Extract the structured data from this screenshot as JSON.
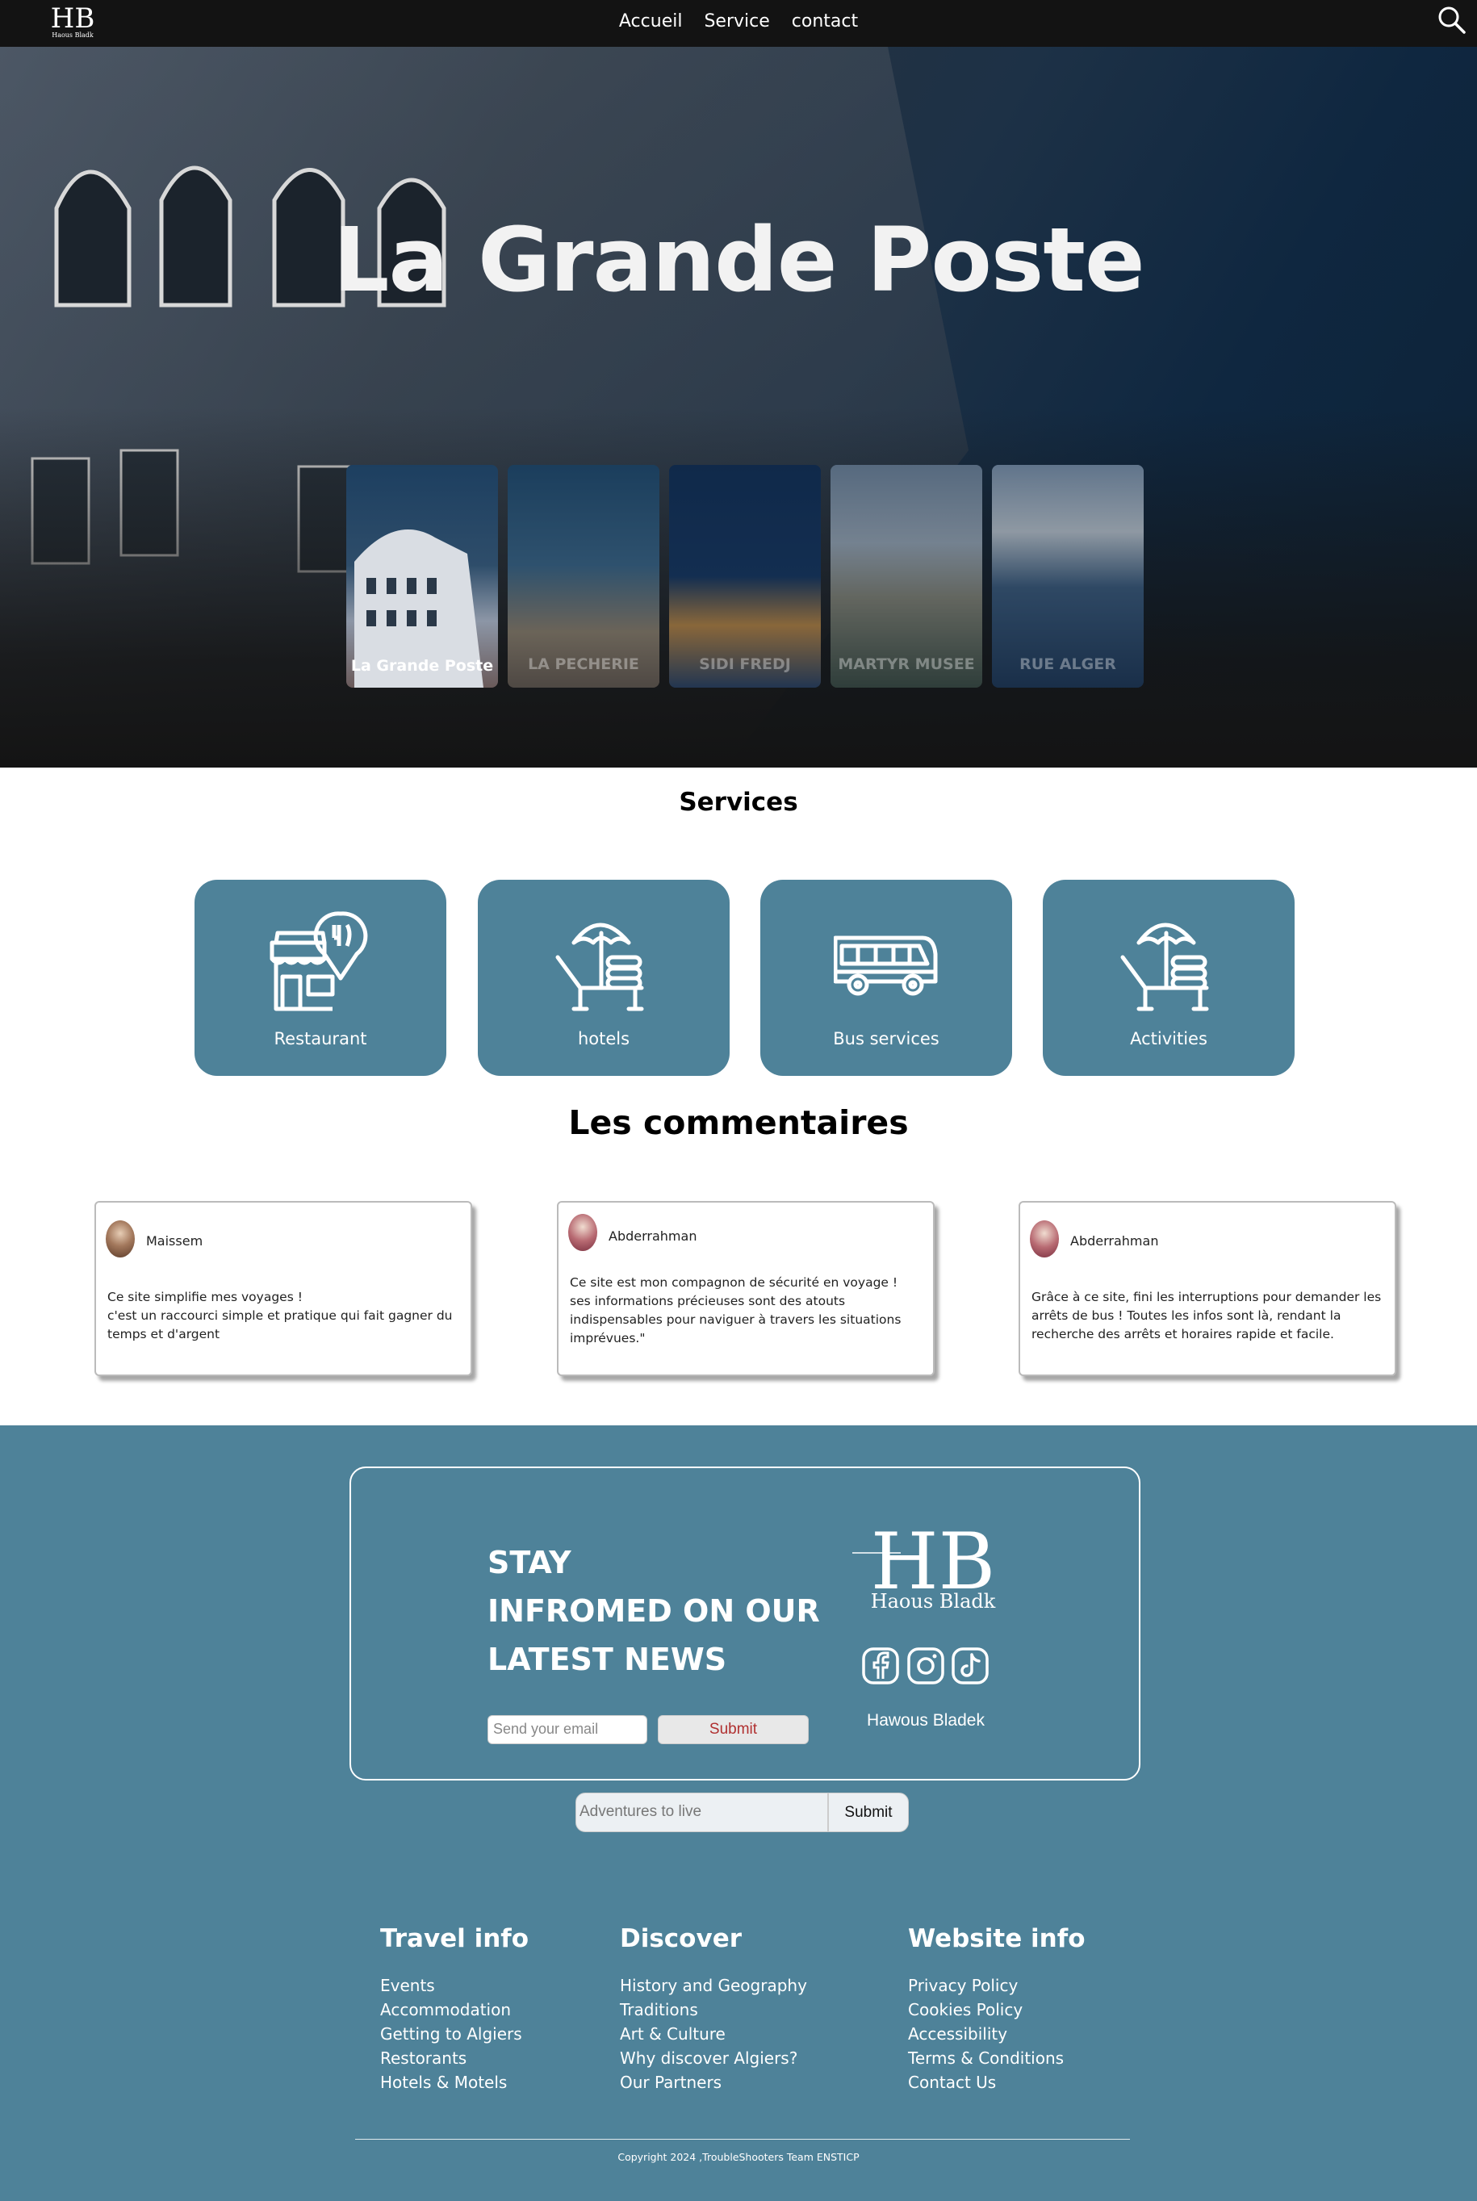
{
  "nav": {
    "logo_text": "HB",
    "logo_sub": "Haous Bladk",
    "links": [
      "Accueil",
      "Service",
      "contact"
    ]
  },
  "hero": {
    "title": "La Grande Poste",
    "cards": [
      {
        "label": "La Grande Poste",
        "active": true
      },
      {
        "label": "LA PECHERIE",
        "active": false
      },
      {
        "label": "SIDI FREDJ",
        "active": false
      },
      {
        "label": "MARTYR MUSEE",
        "active": false
      },
      {
        "label": "RUE ALGER",
        "active": false
      }
    ]
  },
  "services": {
    "title": "Services",
    "items": [
      {
        "label": "Restaurant",
        "icon": "restaurant-icon"
      },
      {
        "label": "hotels",
        "icon": "beach-chair-icon"
      },
      {
        "label": "Bus services",
        "icon": "bus-icon"
      },
      {
        "label": "Activities",
        "icon": "beach-chair-icon"
      }
    ]
  },
  "comments": {
    "title": "Les commentaires",
    "items": [
      {
        "name": "Maissem",
        "text": "Ce site simplifie mes voyages !\nc'est un raccourci simple et pratique qui fait gagner du temps et d'argent"
      },
      {
        "name": "Abderrahman",
        "text": "Ce site est mon compagnon de sécurité en voyage ! ses informations précieuses sont des atouts indispensables pour naviguer à travers les situations imprévues.\""
      },
      {
        "name": "Abderrahman",
        "text": "Grâce à ce site, fini les interruptions pour demander les arrêts de bus ! Toutes les infos sont là, rendant la recherche des arrêts et horaires rapide et facile."
      }
    ]
  },
  "newsletter": {
    "title_lines": [
      "STAY",
      "INFROMED ON OUR",
      "LATEST NEWS"
    ],
    "email_placeholder": "Send your email",
    "submit_label": "Submit",
    "brand_logo_text": "HB",
    "brand_logo_sub": "Haous Bladk",
    "socials": [
      "facebook-icon",
      "instagram-icon",
      "tiktok-icon"
    ],
    "brand_name": "Hawous Bladek"
  },
  "adventure": {
    "placeholder": "Adventures to live",
    "submit_label": "Submit"
  },
  "footer": {
    "columns": [
      {
        "title": "Travel info",
        "items": [
          "Events",
          "Accommodation",
          "Getting to Algiers",
          "Restorants",
          "Hotels & Motels"
        ]
      },
      {
        "title": "Discover",
        "items": [
          "History and Geography",
          "Traditions",
          "Art & Culture",
          "Why discover Algiers?",
          "Our Partners"
        ]
      },
      {
        "title": "Website info",
        "items": [
          "Privacy Policy",
          "Cookies Policy",
          "Accessibility",
          "Terms & Conditions",
          "Contact Us"
        ]
      }
    ],
    "copyright": "Copyright 2024 ,TroubleShooters Team ENSTICP"
  },
  "colors": {
    "accent": "#4e8299",
    "nav_bg": "#131313",
    "submit_text": "#b03030"
  }
}
